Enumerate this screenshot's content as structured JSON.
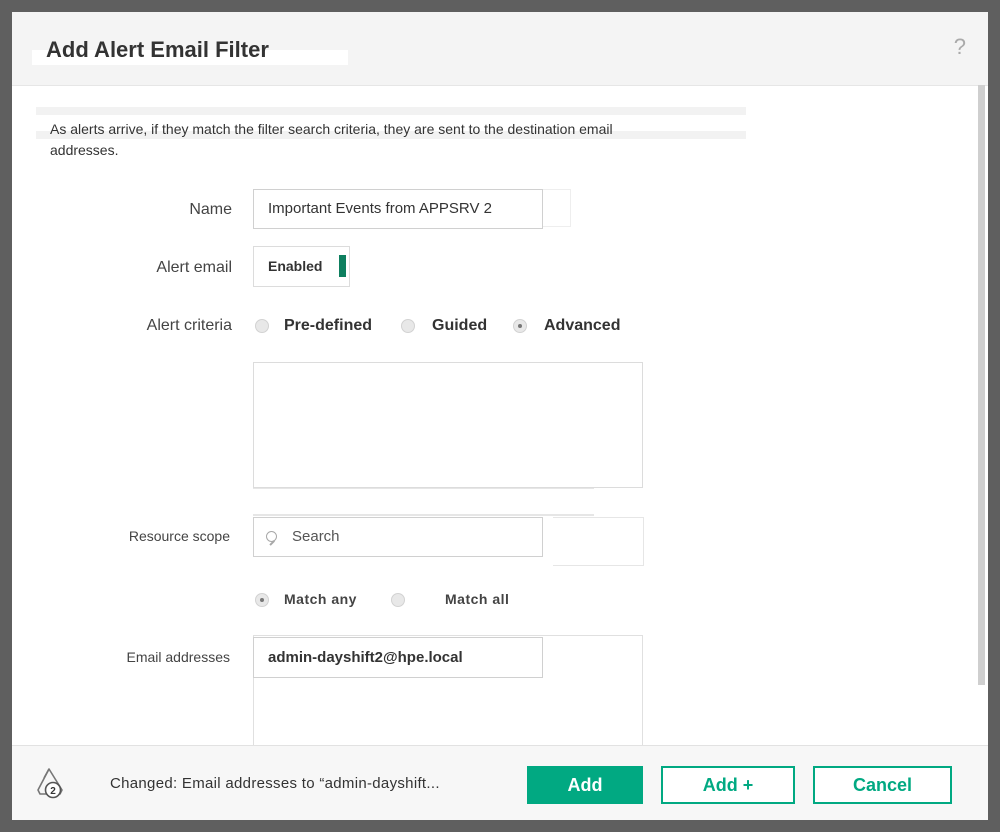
{
  "dialog": {
    "title": "Add Alert Email Filter",
    "help": "?",
    "description_line1": "As  alerts arrive, if they match the filter search criteria, they are sent to the destination email",
    "description_line2": "addresses."
  },
  "form": {
    "name_label": "Name",
    "name_value": "Important Events from APPSRV 2",
    "alert_email_label": "Alert email",
    "alert_email_toggle": "Enabled",
    "alert_criteria_label": "Alert criteria",
    "criteria_options": [
      {
        "label": "Pre-defined",
        "selected": false
      },
      {
        "label": "Guided",
        "selected": false
      },
      {
        "label": "Advanced",
        "selected": true
      }
    ],
    "resource_scope_label": "Resource scope",
    "search_placeholder": "Search",
    "match_options": [
      {
        "label": "Match any",
        "selected": true
      },
      {
        "label": "Match all",
        "selected": false
      }
    ],
    "email_label": "Email addresses",
    "email_value": "admin-dayshift2@hpe.local"
  },
  "footer": {
    "activity_count": "2",
    "status": "Changed: Email addresses to “admin-dayshift...",
    "add_label": "Add",
    "add_plus_label": "Add +",
    "cancel_label": "Cancel"
  },
  "colors": {
    "accent": "#01a982",
    "toggle_on": "#0e7f5f"
  }
}
